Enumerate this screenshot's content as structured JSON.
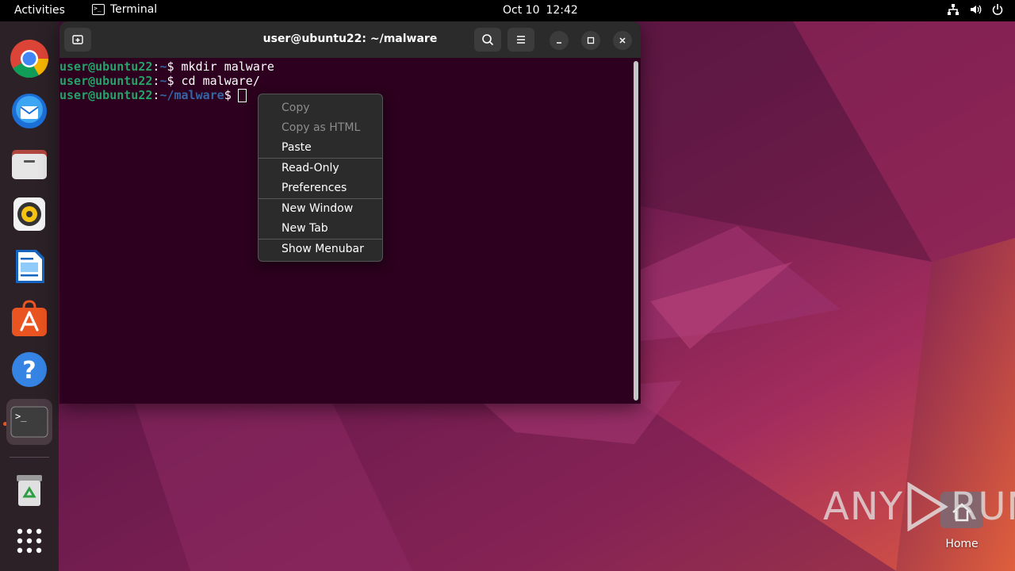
{
  "topbar": {
    "activities": "Activities",
    "app_name": "Terminal",
    "date": "Oct 10",
    "time": "12:42"
  },
  "dock": {
    "items": [
      {
        "name": "chrome"
      },
      {
        "name": "thunderbird"
      },
      {
        "name": "files"
      },
      {
        "name": "rhythmbox"
      },
      {
        "name": "libreoffice-writer"
      },
      {
        "name": "app-center"
      },
      {
        "name": "help"
      },
      {
        "name": "terminal",
        "active": true
      },
      {
        "name": "trash"
      },
      {
        "name": "show-apps"
      }
    ]
  },
  "terminal": {
    "title": "user@ubuntu22: ~/malware",
    "lines": [
      {
        "user": "user@ubuntu22",
        "sep": ":",
        "path": "~",
        "prompt": "$ ",
        "cmd": "mkdir malware"
      },
      {
        "user": "user@ubuntu22",
        "sep": ":",
        "path": "~",
        "prompt": "$ ",
        "cmd": "cd malware/"
      },
      {
        "user": "user@ubuntu22",
        "sep": ":",
        "path": "~/malware",
        "prompt": "$",
        "cmd": ""
      }
    ]
  },
  "context_menu": {
    "copy": "Copy",
    "copy_html": "Copy as HTML",
    "paste": "Paste",
    "read_only": "Read-Only",
    "preferences": "Preferences",
    "new_window": "New Window",
    "new_tab": "New Tab",
    "show_menubar": "Show Menubar"
  },
  "desktop": {
    "watermark_left": "ANY",
    "watermark_right": "RUN",
    "home_label": "Home"
  },
  "colors": {
    "ubuntu_orange": "#e95420",
    "terminal_bg": "#2c001e",
    "prompt_user": "#26a269",
    "prompt_path": "#3465a4"
  }
}
